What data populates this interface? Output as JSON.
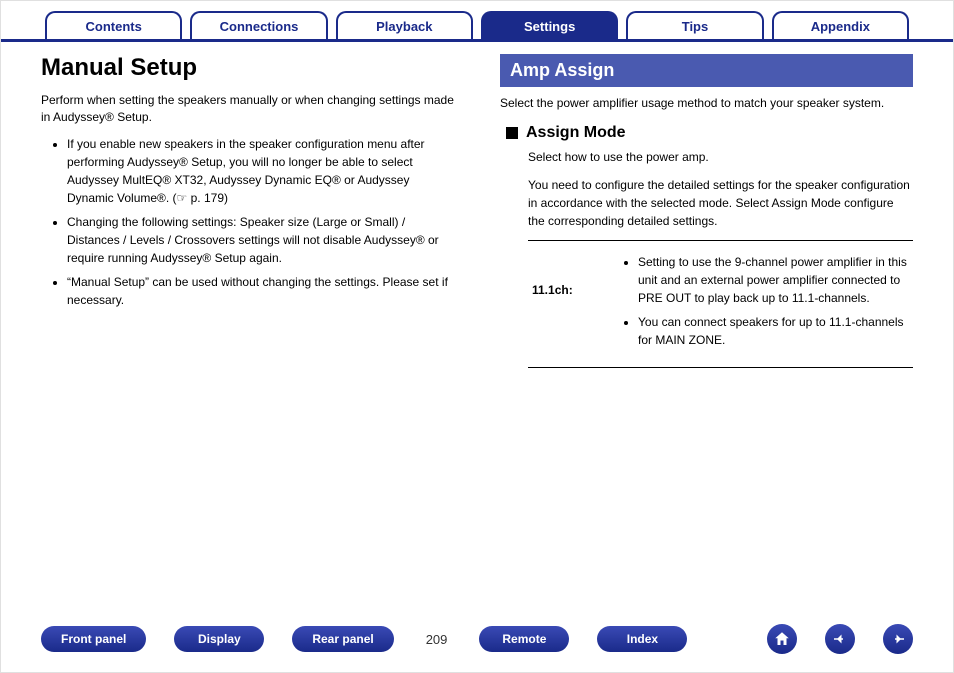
{
  "tabs": {
    "contents": "Contents",
    "connections": "Connections",
    "playback": "Playback",
    "settings": "Settings",
    "tips": "Tips",
    "appendix": "Appendix"
  },
  "left": {
    "title": "Manual Setup",
    "intro": "Perform when setting the speakers manually or when changing settings made in Audyssey® Setup.",
    "bullet1": "If you enable new speakers in the speaker configuration menu after performing Audyssey® Setup, you will no longer be able to select Audyssey MultEQ® XT32, Audyssey Dynamic EQ® or Audyssey Dynamic Volume®.  (☞ p. 179)",
    "bullet2": "Changing the following settings:\nSpeaker size (Large or Small) / Distances / Levels / Crossovers settings will not disable Audyssey® or require running Audyssey® Setup again.",
    "bullet3": "“Manual Setup” can be used without changing the settings. Please set if necessary."
  },
  "right": {
    "section": "Amp Assign",
    "intro": "Select the power amplifier usage method to match your speaker system.",
    "subhead": "Assign Mode",
    "subtext1": "Select how to use the power amp.",
    "subtext2": "You need to configure the detailed settings for the speaker configuration in accordance with the selected mode. Select Assign Mode configure the corresponding detailed settings.",
    "row": {
      "label": "11.1ch:",
      "b1": "Setting to use the 9-channel power amplifier in this unit and an external power amplifier connected to PRE OUT to play back up to 11.1-channels.",
      "b2": "You can connect speakers for up to 11.1-channels for MAIN ZONE."
    }
  },
  "footer": {
    "front": "Front panel",
    "display": "Display",
    "rear": "Rear panel",
    "page": "209",
    "remote": "Remote",
    "index": "Index"
  }
}
